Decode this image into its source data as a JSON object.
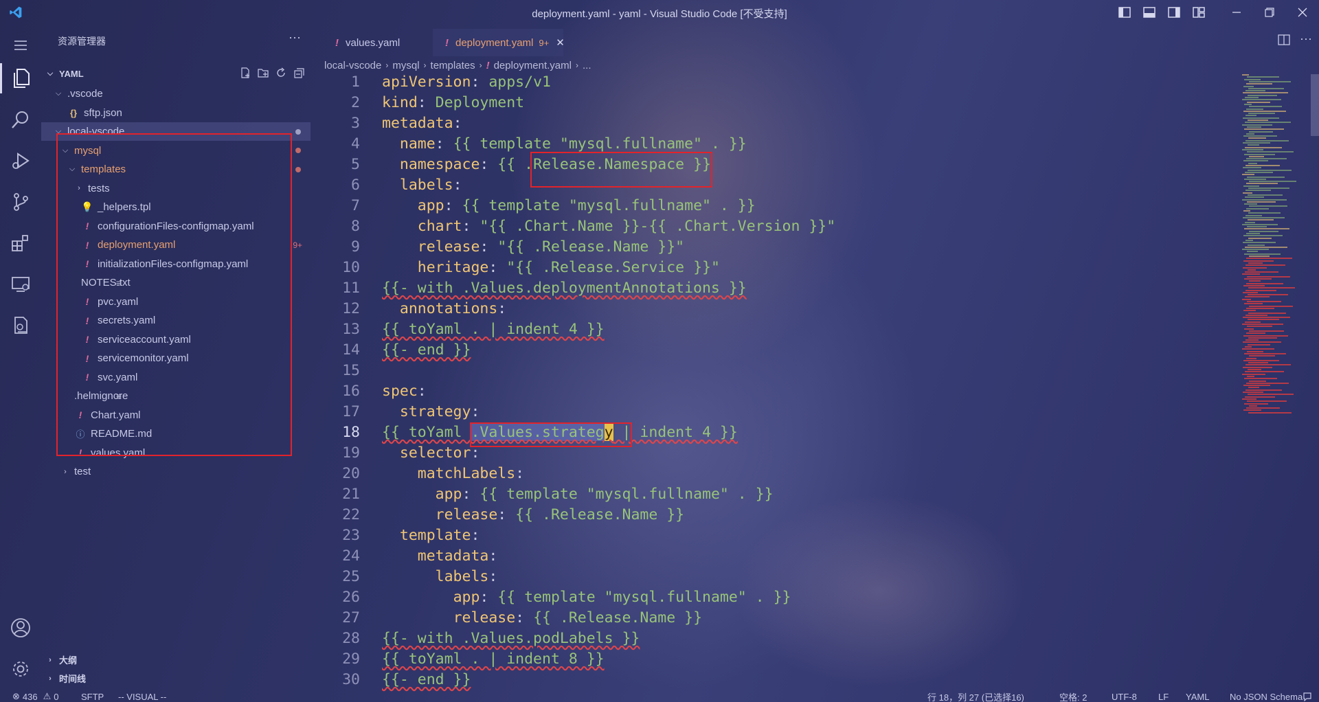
{
  "window": {
    "title": "deployment.yaml - yaml - Visual Studio Code [不受支持]"
  },
  "sidebar": {
    "title": "资源管理器",
    "more": "···",
    "workspace": "YAML",
    "tree": [
      {
        "label": ".vscode",
        "depth": 1,
        "kind": "folder-open"
      },
      {
        "label": "sftp.json",
        "depth": 2,
        "kind": "json"
      },
      {
        "label": "local-vscode",
        "depth": 1,
        "kind": "folder-open"
      },
      {
        "label": "mysql",
        "depth": 2,
        "kind": "folder-open"
      },
      {
        "label": "templates",
        "depth": 3,
        "kind": "folder-open"
      },
      {
        "label": "tests",
        "depth": 4,
        "kind": "folder-closed"
      },
      {
        "label": "_helpers.tpl",
        "depth": 4,
        "kind": "tpl"
      },
      {
        "label": "configurationFiles-configmap.yaml",
        "depth": 4,
        "kind": "yaml"
      },
      {
        "label": "deployment.yaml",
        "depth": 4,
        "kind": "yaml",
        "badge": "9+"
      },
      {
        "label": "initializationFiles-configmap.yaml",
        "depth": 4,
        "kind": "yaml"
      },
      {
        "label": "NOTES.txt",
        "depth": 4,
        "kind": "txt"
      },
      {
        "label": "pvc.yaml",
        "depth": 4,
        "kind": "yaml"
      },
      {
        "label": "secrets.yaml",
        "depth": 4,
        "kind": "yaml"
      },
      {
        "label": "serviceaccount.yaml",
        "depth": 4,
        "kind": "yaml"
      },
      {
        "label": "servicemonitor.yaml",
        "depth": 4,
        "kind": "yaml"
      },
      {
        "label": "svc.yaml",
        "depth": 4,
        "kind": "yaml"
      },
      {
        "label": ".helmignore",
        "depth": 3,
        "kind": "txt"
      },
      {
        "label": "Chart.yaml",
        "depth": 3,
        "kind": "yaml"
      },
      {
        "label": "README.md",
        "depth": 3,
        "kind": "info"
      },
      {
        "label": "values.yaml",
        "depth": 3,
        "kind": "yaml"
      },
      {
        "label": "test",
        "depth": 2,
        "kind": "folder-closed"
      }
    ],
    "outline": "大纲",
    "timeline": "时间线"
  },
  "tabs": [
    {
      "label": "values.yaml",
      "active": false
    },
    {
      "label": "deployment.yaml",
      "active": true,
      "count": "9+"
    }
  ],
  "breadcrumb": [
    "local-vscode",
    "mysql",
    "templates",
    "deployment.yaml",
    "..."
  ],
  "code": [
    "apiVersion: apps/v1",
    "kind: Deployment",
    "metadata:",
    "  name: {{ template \"mysql.fullname\" . }}",
    "  namespace: {{ .Release.Namespace }}",
    "  labels:",
    "    app: {{ template \"mysql.fullname\" . }}",
    "    chart: \"{{ .Chart.Name }}-{{ .Chart.Version }}\"",
    "    release: \"{{ .Release.Name }}\"",
    "    heritage: \"{{ .Release.Service }}\"",
    "{{- with .Values.deploymentAnnotations }}",
    "  annotations:",
    "{{ toYaml . | indent 4 }}",
    "{{- end }}",
    "",
    "spec:",
    "  strategy:",
    "{{ toYaml .Values.strategy | indent 4 }}",
    "  selector:",
    "    matchLabels:",
    "      app: {{ template \"mysql.fullname\" . }}",
    "      release: {{ .Release.Name }}",
    "  template:",
    "    metadata:",
    "      labels:",
    "        app: {{ template \"mysql.fullname\" . }}",
    "        release: {{ .Release.Name }}",
    "{{- with .Values.podLabels }}",
    "{{ toYaml . | indent 8 }}",
    "{{- end }}"
  ],
  "status": {
    "errors": "436",
    "warnings": "0",
    "sftp": "SFTP",
    "mode": "-- VISUAL --",
    "position": "行 18，列 27 (已选择16)",
    "spaces": "空格: 2",
    "encoding": "UTF-8",
    "eol": "LF",
    "language": "YAML",
    "schema": "No JSON Schema"
  },
  "colors": {
    "key": "#f0c674",
    "value": "#98c379",
    "error": "#e0454a",
    "highlight_box": "#e2232b",
    "modified": "#e8a070"
  }
}
